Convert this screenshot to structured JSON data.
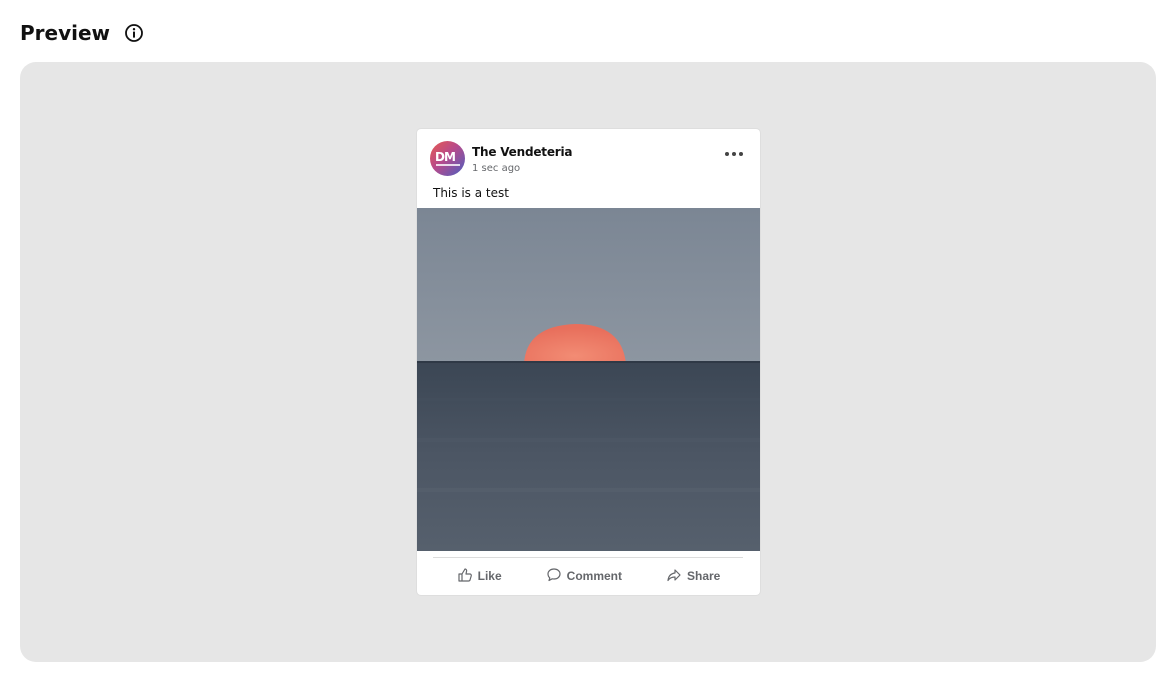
{
  "header": {
    "title": "Preview",
    "info_icon": "info-icon"
  },
  "post": {
    "page_name": "The Vendeteria",
    "timestamp": "1 sec ago",
    "text": "This is a test",
    "avatar_initials": "DM",
    "more_icon": "more-horizontal-icon",
    "photo_description": "sunset over sea"
  },
  "actions": {
    "like": {
      "label": "Like",
      "icon": "thumbs-up-icon"
    },
    "comment": {
      "label": "Comment",
      "icon": "comment-icon"
    },
    "share": {
      "label": "Share",
      "icon": "share-icon"
    }
  },
  "colors": {
    "preview_bg": "#e6e6e6",
    "card_bg": "#ffffff",
    "muted_text": "#65676b"
  }
}
